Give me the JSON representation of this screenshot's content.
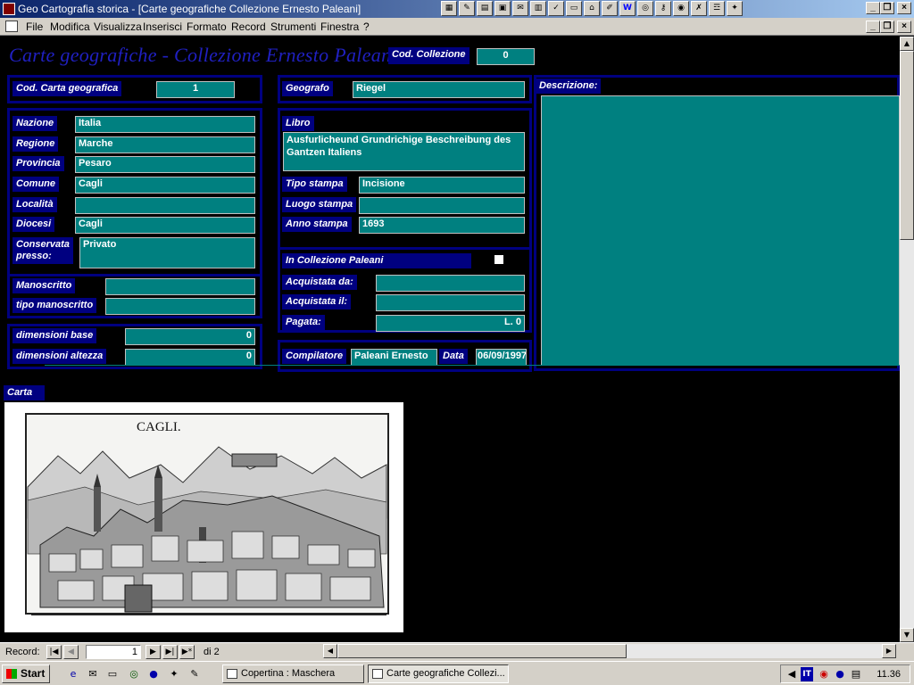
{
  "window": {
    "title": "Geo Cartografia storica - [Carte geografiche Collezione Ernesto Paleani]"
  },
  "menu": {
    "items": [
      "File",
      "Modifica",
      "Visualizza",
      "Inserisci",
      "Formato",
      "Record",
      "Strumenti",
      "Finestra",
      "?"
    ]
  },
  "form": {
    "title": "Carte geografiche - Collezione Ernesto Paleani",
    "cod_collezione": {
      "label": "Cod. Collezione",
      "value": "0"
    },
    "cod_carta": {
      "label": "Cod. Carta geografica",
      "value": "1"
    },
    "geografo": {
      "label": "Geografo",
      "value": "Riegel"
    },
    "descrizione": {
      "label": "Descrizione:",
      "value": ""
    },
    "nazione": {
      "label": "Nazione",
      "value": "Italia"
    },
    "regione": {
      "label": "Regione",
      "value": "Marche"
    },
    "provincia": {
      "label": "Provincia",
      "value": "Pesaro"
    },
    "comune": {
      "label": "Comune",
      "value": "Cagli"
    },
    "localita": {
      "label": "Località",
      "value": ""
    },
    "diocesi": {
      "label": "Diocesi",
      "value": "Cagli"
    },
    "conservata": {
      "label1": "Conservata",
      "label2": "presso:",
      "value": "Privato"
    },
    "libro": {
      "label": "Libro",
      "value": "Ausfurlicheund Grundrichige Beschreibung des Gantzen Italiens"
    },
    "tipo_stampa": {
      "label": "Tipo stampa",
      "value": "Incisione"
    },
    "luogo_stampa": {
      "label": "Luogo stampa",
      "value": ""
    },
    "anno_stampa": {
      "label": "Anno stampa",
      "value": "1693"
    },
    "manoscritto": {
      "label": "Manoscritto",
      "value": ""
    },
    "tipo_manoscritto": {
      "label": "tipo manoscritto",
      "value": ""
    },
    "in_collezione": {
      "label": "In Collezione Paleani",
      "checked": false
    },
    "acquistata_da": {
      "label": "Acquistata da:",
      "value": ""
    },
    "acquistata_il": {
      "label": "Acquistata il:",
      "value": ""
    },
    "pagata": {
      "label": "Pagata:",
      "value": "L. 0"
    },
    "dim_base": {
      "label": "dimensioni base",
      "value": "0"
    },
    "dim_altezza": {
      "label": "dimensioni altezza",
      "value": "0"
    },
    "compilatore": {
      "label": "Compilatore",
      "value": "Paleani Ernesto"
    },
    "data": {
      "label": "Data",
      "value": "06/09/1997"
    },
    "carta": {
      "label": "Carta",
      "image_caption": "CAGLI."
    }
  },
  "record_nav": {
    "label": "Record:",
    "current": "1",
    "of_text": "di 2"
  },
  "taskbar": {
    "start": "Start",
    "tasks": [
      "Copertina : Maschera",
      "Carte geografiche Collezi..."
    ],
    "lang": "IT",
    "clock": "11.36"
  },
  "colors": {
    "field_bg": "#008080",
    "label_bg": "#000080",
    "title_text": "#2020c0"
  }
}
